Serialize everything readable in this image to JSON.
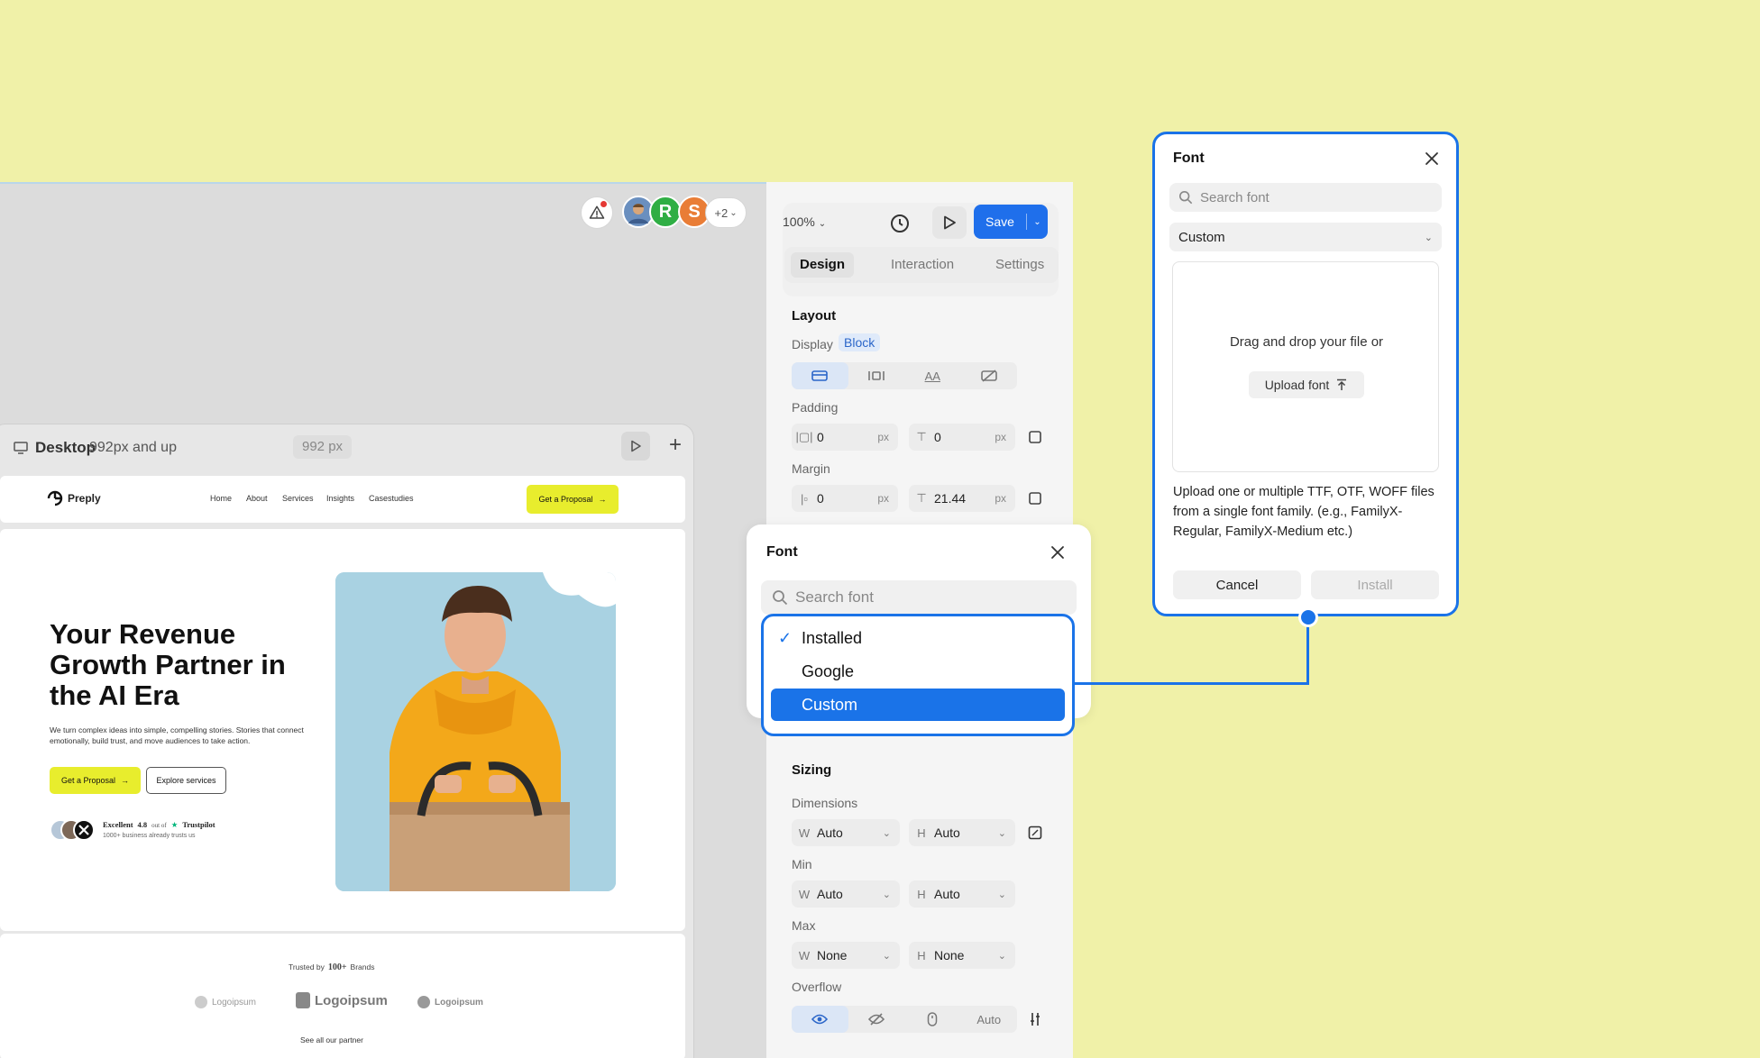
{
  "colors": {
    "background": "#f0f1a8",
    "accent": "#1a73e8",
    "brand_yellow": "#e8ed2d"
  },
  "toolbar": {
    "avatars": [
      {
        "label": "",
        "color": "#6a8fbf"
      },
      {
        "label": "R",
        "color": "#2fae44"
      },
      {
        "label": "S",
        "color": "#e97d36"
      }
    ],
    "more_avatars": "+2",
    "zoom": "100%",
    "save_label": "Save",
    "tabs": [
      "Design",
      "Interaction",
      "Settings"
    ]
  },
  "breakpoint": {
    "name": "Desktop",
    "range": "992px and up",
    "width": "992 px"
  },
  "site": {
    "brand": "Preply",
    "nav": [
      "Home",
      "About",
      "Services",
      "Insights",
      "Casestudies"
    ],
    "cta": "Get a Proposal",
    "hero_title": "Your Revenue Growth Partner in the AI Era",
    "hero_desc": "We turn complex ideas into simple, compelling stories. Stories that connect emotionally, build trust, and move audiences to take action.",
    "primary_btn": "Get a Proposal",
    "secondary_btn": "Explore services",
    "rating_label": "Excellent",
    "rating_value": "4.8",
    "rating_of": "out of",
    "rating_source": "Trustpilot",
    "rating_sub": "1000+ business already trusts us",
    "trusted_prefix": "Trusted by",
    "trusted_count": "100+",
    "trusted_suffix": "Brands",
    "logos": [
      "Logoipsum",
      "Logoipsum",
      "Logoipsum"
    ],
    "see_all": "See all our partner"
  },
  "layout_panel": {
    "title": "Layout",
    "display_label": "Display",
    "display_value": "Block",
    "display_options": [
      "block-icon",
      "flex-icon",
      "text-icon",
      "none-icon"
    ],
    "padding_label": "Padding",
    "padding_h": "0",
    "padding_v": "0",
    "margin_label": "Margin",
    "margin_h": "0",
    "margin_v": "21.44",
    "unit": "px"
  },
  "font_popover": {
    "title": "Font",
    "search_placeholder": "Search font",
    "options": [
      "Installed",
      "Google",
      "Custom"
    ],
    "checked": "Installed",
    "selected": "Custom"
  },
  "sizing_panel": {
    "title": "Sizing",
    "dimensions_label": "Dimensions",
    "w_label": "W",
    "h_label": "H",
    "dim_w": "Auto",
    "dim_h": "Auto",
    "min_label": "Min",
    "min_w": "Auto",
    "min_h": "Auto",
    "max_label": "Max",
    "max_w": "None",
    "max_h": "None",
    "overflow_label": "Overflow",
    "overflow_auto": "Auto"
  },
  "font_dialog": {
    "title": "Font",
    "search_placeholder": "Search font",
    "source": "Custom",
    "drop_text": "Drag and drop your file or",
    "upload_label": "Upload font",
    "help_text": "Upload one or multiple TTF, OTF, WOFF files from a single font family. (e.g., FamilyX-Regular, FamilyX-Medium etc.)",
    "cancel_label": "Cancel",
    "install_label": "Install"
  }
}
